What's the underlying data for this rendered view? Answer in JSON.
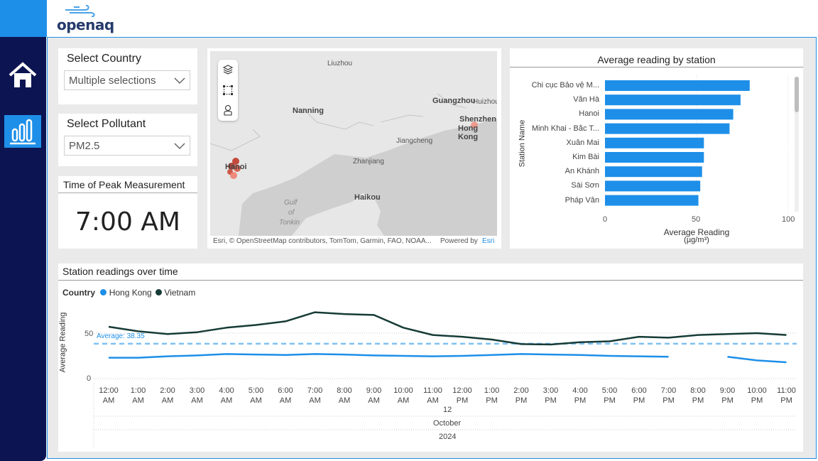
{
  "logo": {
    "text": "openaq"
  },
  "nav": {
    "home": "home-icon",
    "report": "bar-chart-icon"
  },
  "country_slicer": {
    "title": "Select Country",
    "value": "Multiple selections"
  },
  "pollutant_slicer": {
    "title": "Select Pollutant",
    "value": "PM2.5"
  },
  "peak_card": {
    "title": "Time of Peak Measurement",
    "value": "7:00 AM"
  },
  "map": {
    "attribution": "Esri, © OpenStreetMap contributors, TomTom, Garmin, FAO, NOAA...",
    "powered_by": "Powered by",
    "esri": "Esri",
    "labels": {
      "liuzhou": "Liuzhou",
      "nanning": "Nanning",
      "guangzhou": "Guangzhou",
      "huizhou": "Huizhou",
      "shenzhen": "Shenzhen",
      "hongkong": "Hong Kong",
      "jiangcheng": "Jiangcheng",
      "zhanjiang": "Zhanjiang",
      "hanoi": "Hanoi",
      "haikou": "Haikou",
      "gulf1": "Gulf",
      "gulf2": "of",
      "gulf3": "Tonkin"
    }
  },
  "bar_chart": {
    "title": "Average reading by station",
    "ylabel": "Station Name",
    "xlabel": "Average Reading",
    "xlabel_unit": "(µg/m³)",
    "xticks": [
      "0",
      "50",
      "100"
    ],
    "color": "#1e8fe8"
  },
  "line_chart": {
    "title": "Station readings over time",
    "legend_title": "Country",
    "ylabel": "Average Reading",
    "yticks": [
      "0",
      "50"
    ],
    "average_label": "Average: 38.35",
    "day": "12",
    "month": "October",
    "year": "2024",
    "colors": {
      "hk": "#1e8fe8",
      "vn": "#163b36",
      "avg": "#7ec1f2"
    }
  },
  "chart_data": [
    {
      "type": "bar",
      "title": "Average reading by station",
      "ylabel": "Station Name",
      "xlabel": "Average Reading (µg/m³)",
      "categories": [
        "Chi cục Bảo vệ M...",
        "Vân Hà",
        "Hanoi",
        "Minh Khai - Bắc T...",
        "Xuân Mai",
        "Kim Bài",
        "An Khánh",
        "Sài Sơn",
        "Pháp Vân"
      ],
      "values": [
        79,
        74,
        70,
        68,
        54,
        54,
        53,
        52,
        51
      ],
      "xlim": [
        0,
        100
      ]
    },
    {
      "type": "line",
      "title": "Station readings over time",
      "ylabel": "Average Reading",
      "ylim": [
        0,
        80
      ],
      "x": [
        "12:00 AM",
        "1:00 AM",
        "2:00 AM",
        "3:00 AM",
        "4:00 AM",
        "5:00 AM",
        "6:00 AM",
        "7:00 AM",
        "8:00 AM",
        "9:00 AM",
        "10:00 AM",
        "11:00 AM",
        "12:00 PM",
        "1:00 PM",
        "2:00 PM",
        "3:00 PM",
        "4:00 PM",
        "5:00 PM",
        "6:00 PM",
        "7:00 PM",
        "8:00 PM",
        "9:00 PM",
        "10:00 PM",
        "11:00 PM"
      ],
      "average": 38.35,
      "series": [
        {
          "name": "Hong Kong",
          "values": [
            23,
            23,
            24.5,
            25.5,
            27,
            26.5,
            26,
            27,
            26.5,
            25.5,
            25,
            24.5,
            25,
            26,
            27,
            26.5,
            26,
            25,
            24.5,
            24,
            null,
            24,
            20,
            18
          ]
        },
        {
          "name": "Vietnam",
          "values": [
            57,
            52,
            49,
            51,
            56,
            59,
            63,
            73,
            71,
            70,
            56,
            48,
            46,
            43,
            38,
            37.5,
            40,
            41,
            46,
            45,
            48,
            49,
            50,
            48
          ]
        }
      ]
    }
  ]
}
